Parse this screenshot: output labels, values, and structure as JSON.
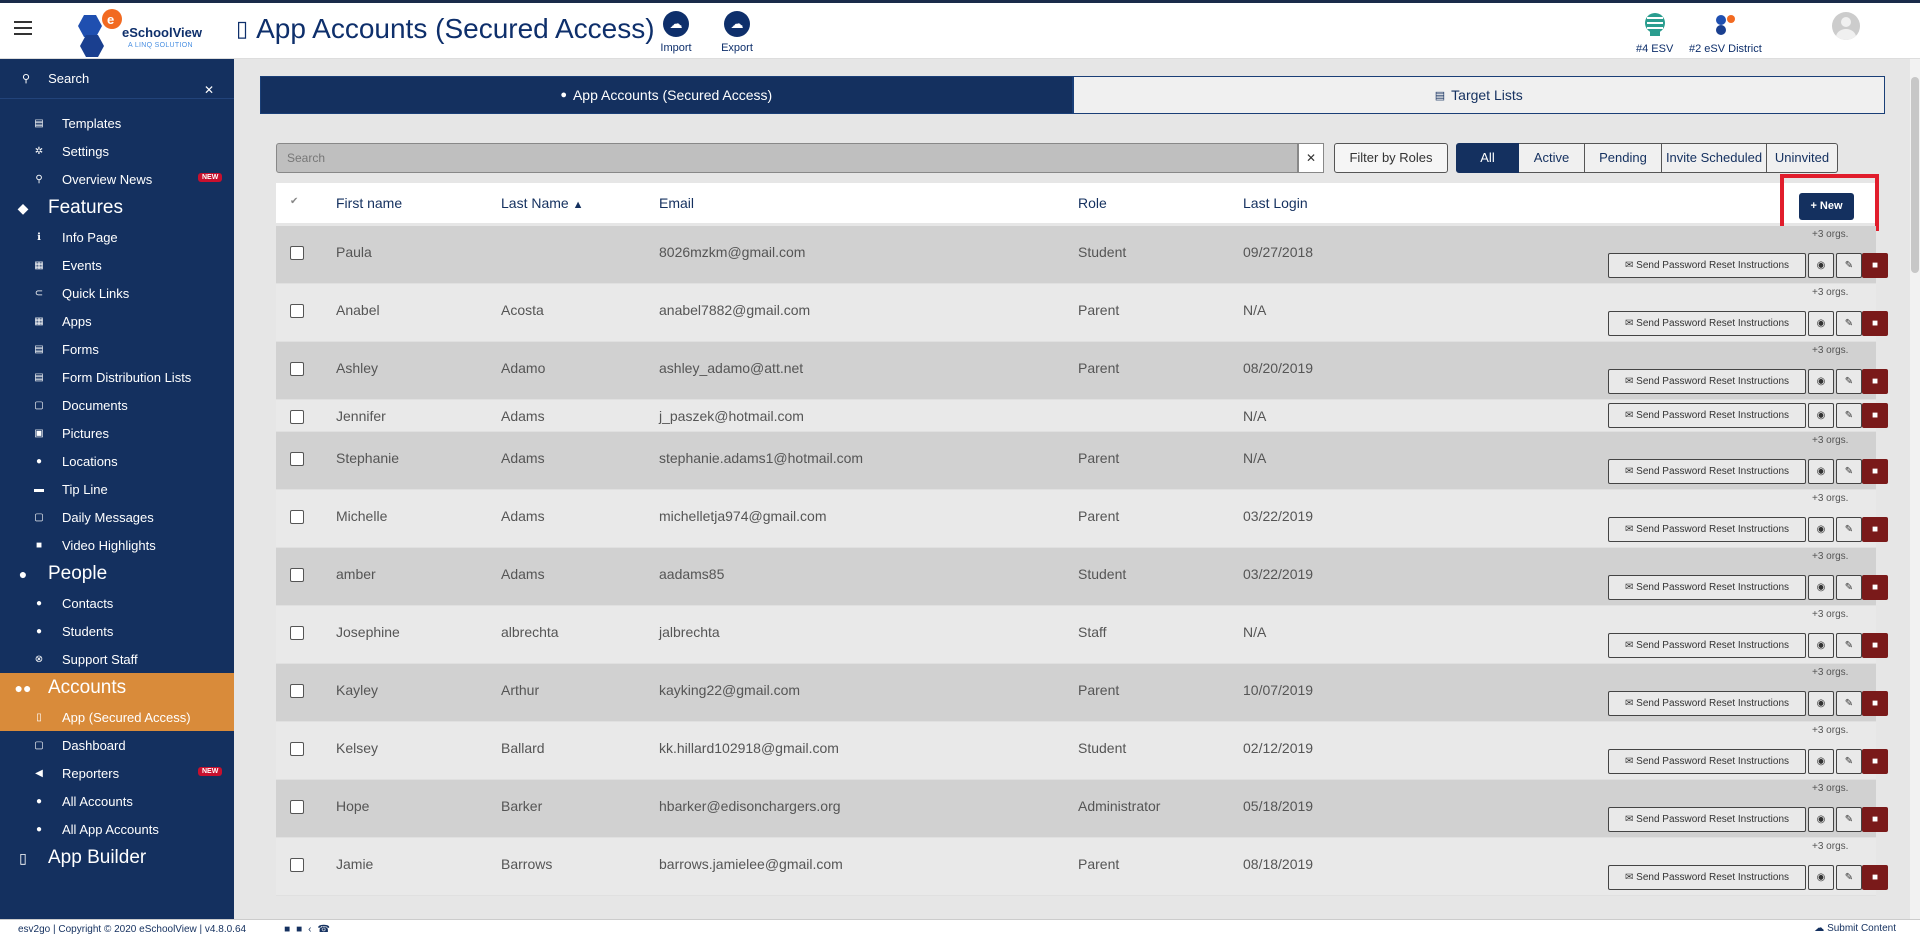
{
  "header": {
    "brand": "eSchoolView",
    "brand_sub": "A LINQ SOLUTION",
    "page_title": "App Accounts (Secured Access)",
    "import_label": "Import",
    "export_label": "Export",
    "org1_label": "#4 ESV",
    "org2_label": "#2 eSV District"
  },
  "sidebar": {
    "search_label": "Search",
    "top_items": [
      {
        "label": "Templates",
        "icon": "template-icon"
      },
      {
        "label": "Settings",
        "icon": "gear-icon"
      },
      {
        "label": "Overview News",
        "icon": "search-icon",
        "badge": "NEW"
      }
    ],
    "features_label": "Features",
    "features": [
      {
        "label": "Info Page",
        "icon": "info-icon"
      },
      {
        "label": "Events",
        "icon": "calendar-icon"
      },
      {
        "label": "Quick Links",
        "icon": "link-icon"
      },
      {
        "label": "Apps",
        "icon": "grid-icon"
      },
      {
        "label": "Forms",
        "icon": "form-icon"
      },
      {
        "label": "Form Distribution Lists",
        "icon": "list-icon"
      },
      {
        "label": "Documents",
        "icon": "document-icon"
      },
      {
        "label": "Pictures",
        "icon": "picture-icon"
      },
      {
        "label": "Locations",
        "icon": "map-pin-icon"
      },
      {
        "label": "Tip Line",
        "icon": "tip-icon"
      },
      {
        "label": "Daily Messages",
        "icon": "message-icon"
      },
      {
        "label": "Video Highlights",
        "icon": "video-icon"
      }
    ],
    "people_label": "People",
    "people": [
      {
        "label": "Contacts",
        "icon": "contacts-icon"
      },
      {
        "label": "Students",
        "icon": "students-icon"
      },
      {
        "label": "Support Staff",
        "icon": "support-icon"
      }
    ],
    "accounts_label": "Accounts",
    "accounts": [
      {
        "label": "App (Secured Access)",
        "icon": "phone-icon"
      },
      {
        "label": "Dashboard",
        "icon": "dashboard-icon"
      },
      {
        "label": "Reporters",
        "icon": "megaphone-icon",
        "badge": "NEW"
      },
      {
        "label": "All Accounts",
        "icon": "users-icon"
      },
      {
        "label": "All App Accounts",
        "icon": "users-icon"
      }
    ],
    "app_builder_label": "App Builder"
  },
  "tabs": {
    "accounts_tab": "App Accounts (Secured Access)",
    "target_tab": "Target Lists"
  },
  "toolbar": {
    "search_placeholder": "Search",
    "filter_roles": "Filter by Roles",
    "statuses": [
      "All",
      "Active",
      "Pending",
      "Invite Scheduled",
      "Uninvited"
    ]
  },
  "table": {
    "headers": {
      "first_name": "First name",
      "last_name": "Last Name",
      "email": "Email",
      "role": "Role",
      "last_login": "Last Login"
    },
    "new_label": "+ New",
    "reset_label": "Send Password Reset Instructions",
    "orgs_note": "+3 orgs.",
    "rows": [
      {
        "first": "Paula",
        "last": "",
        "email": "8026mzkm@gmail.com",
        "role": "Student",
        "login": "09/27/2018",
        "orgs": true
      },
      {
        "first": "Anabel",
        "last": "Acosta",
        "email": "anabel7882@gmail.com",
        "role": "Parent",
        "login": "N/A",
        "orgs": true
      },
      {
        "first": "Ashley",
        "last": "Adamo",
        "email": "ashley_adamo@att.net",
        "role": "Parent",
        "login": "08/20/2019",
        "orgs": true
      },
      {
        "first": "Jennifer",
        "last": "Adams",
        "email": "j_paszek@hotmail.com",
        "role": "",
        "login": "N/A",
        "orgs": false
      },
      {
        "first": "Stephanie",
        "last": "Adams",
        "email": "stephanie.adams1@hotmail.com",
        "role": "Parent",
        "login": "N/A",
        "orgs": true
      },
      {
        "first": "Michelle",
        "last": "Adams",
        "email": "michelletja974@gmail.com",
        "role": "Parent",
        "login": "03/22/2019",
        "orgs": true
      },
      {
        "first": "amber",
        "last": "Adams",
        "email": "aadams85",
        "role": "Student",
        "login": "03/22/2019",
        "orgs": true
      },
      {
        "first": "Josephine",
        "last": "albrechta",
        "email": "jalbrechta",
        "role": "Staff",
        "login": "N/A",
        "orgs": true
      },
      {
        "first": "Kayley",
        "last": "Arthur",
        "email": "kayking22@gmail.com",
        "role": "Parent",
        "login": "10/07/2019",
        "orgs": true
      },
      {
        "first": "Kelsey",
        "last": "Ballard",
        "email": "kk.hillard102918@gmail.com",
        "role": "Student",
        "login": "02/12/2019",
        "orgs": true
      },
      {
        "first": "Hope",
        "last": "Barker",
        "email": "hbarker@edisonchargers.org",
        "role": "Administrator",
        "login": "05/18/2019",
        "orgs": true
      },
      {
        "first": "Jamie",
        "last": "Barrows",
        "email": "barrows.jamielee@gmail.com",
        "role": "Parent",
        "login": "08/18/2019",
        "orgs": true
      }
    ]
  },
  "footer": {
    "text": "esv2go | Copyright © 2020 eSchoolView | v4.8.0.64",
    "submit": "Submit Content"
  },
  "colors": {
    "navy": "#14305f",
    "accent": "#d98b3a",
    "highlight": "#e11d2c",
    "delete": "#7a1a1a"
  }
}
